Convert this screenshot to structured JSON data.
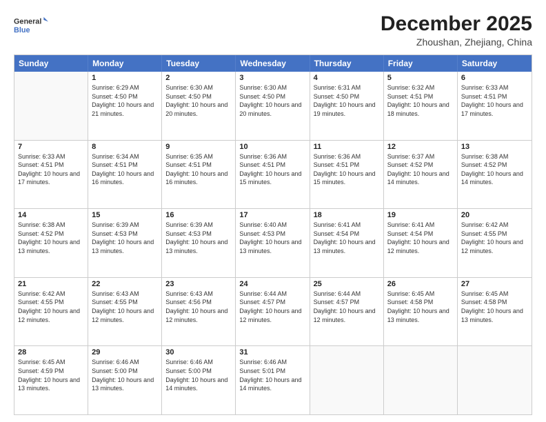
{
  "header": {
    "logo_general": "General",
    "logo_blue": "Blue",
    "month_title": "December 2025",
    "location": "Zhoushan, Zhejiang, China"
  },
  "calendar": {
    "days_of_week": [
      "Sunday",
      "Monday",
      "Tuesday",
      "Wednesday",
      "Thursday",
      "Friday",
      "Saturday"
    ],
    "rows": [
      [
        {
          "day": "",
          "sunrise": "",
          "sunset": "",
          "daylight": ""
        },
        {
          "day": "1",
          "sunrise": "6:29 AM",
          "sunset": "4:50 PM",
          "daylight": "10 hours and 21 minutes."
        },
        {
          "day": "2",
          "sunrise": "6:30 AM",
          "sunset": "4:50 PM",
          "daylight": "10 hours and 20 minutes."
        },
        {
          "day": "3",
          "sunrise": "6:30 AM",
          "sunset": "4:50 PM",
          "daylight": "10 hours and 20 minutes."
        },
        {
          "day": "4",
          "sunrise": "6:31 AM",
          "sunset": "4:50 PM",
          "daylight": "10 hours and 19 minutes."
        },
        {
          "day": "5",
          "sunrise": "6:32 AM",
          "sunset": "4:51 PM",
          "daylight": "10 hours and 18 minutes."
        },
        {
          "day": "6",
          "sunrise": "6:33 AM",
          "sunset": "4:51 PM",
          "daylight": "10 hours and 17 minutes."
        }
      ],
      [
        {
          "day": "7",
          "sunrise": "6:33 AM",
          "sunset": "4:51 PM",
          "daylight": "10 hours and 17 minutes."
        },
        {
          "day": "8",
          "sunrise": "6:34 AM",
          "sunset": "4:51 PM",
          "daylight": "10 hours and 16 minutes."
        },
        {
          "day": "9",
          "sunrise": "6:35 AM",
          "sunset": "4:51 PM",
          "daylight": "10 hours and 16 minutes."
        },
        {
          "day": "10",
          "sunrise": "6:36 AM",
          "sunset": "4:51 PM",
          "daylight": "10 hours and 15 minutes."
        },
        {
          "day": "11",
          "sunrise": "6:36 AM",
          "sunset": "4:51 PM",
          "daylight": "10 hours and 15 minutes."
        },
        {
          "day": "12",
          "sunrise": "6:37 AM",
          "sunset": "4:52 PM",
          "daylight": "10 hours and 14 minutes."
        },
        {
          "day": "13",
          "sunrise": "6:38 AM",
          "sunset": "4:52 PM",
          "daylight": "10 hours and 14 minutes."
        }
      ],
      [
        {
          "day": "14",
          "sunrise": "6:38 AM",
          "sunset": "4:52 PM",
          "daylight": "10 hours and 13 minutes."
        },
        {
          "day": "15",
          "sunrise": "6:39 AM",
          "sunset": "4:53 PM",
          "daylight": "10 hours and 13 minutes."
        },
        {
          "day": "16",
          "sunrise": "6:39 AM",
          "sunset": "4:53 PM",
          "daylight": "10 hours and 13 minutes."
        },
        {
          "day": "17",
          "sunrise": "6:40 AM",
          "sunset": "4:53 PM",
          "daylight": "10 hours and 13 minutes."
        },
        {
          "day": "18",
          "sunrise": "6:41 AM",
          "sunset": "4:54 PM",
          "daylight": "10 hours and 13 minutes."
        },
        {
          "day": "19",
          "sunrise": "6:41 AM",
          "sunset": "4:54 PM",
          "daylight": "10 hours and 12 minutes."
        },
        {
          "day": "20",
          "sunrise": "6:42 AM",
          "sunset": "4:55 PM",
          "daylight": "10 hours and 12 minutes."
        }
      ],
      [
        {
          "day": "21",
          "sunrise": "6:42 AM",
          "sunset": "4:55 PM",
          "daylight": "10 hours and 12 minutes."
        },
        {
          "day": "22",
          "sunrise": "6:43 AM",
          "sunset": "4:55 PM",
          "daylight": "10 hours and 12 minutes."
        },
        {
          "day": "23",
          "sunrise": "6:43 AM",
          "sunset": "4:56 PM",
          "daylight": "10 hours and 12 minutes."
        },
        {
          "day": "24",
          "sunrise": "6:44 AM",
          "sunset": "4:57 PM",
          "daylight": "10 hours and 12 minutes."
        },
        {
          "day": "25",
          "sunrise": "6:44 AM",
          "sunset": "4:57 PM",
          "daylight": "10 hours and 12 minutes."
        },
        {
          "day": "26",
          "sunrise": "6:45 AM",
          "sunset": "4:58 PM",
          "daylight": "10 hours and 13 minutes."
        },
        {
          "day": "27",
          "sunrise": "6:45 AM",
          "sunset": "4:58 PM",
          "daylight": "10 hours and 13 minutes."
        }
      ],
      [
        {
          "day": "28",
          "sunrise": "6:45 AM",
          "sunset": "4:59 PM",
          "daylight": "10 hours and 13 minutes."
        },
        {
          "day": "29",
          "sunrise": "6:46 AM",
          "sunset": "5:00 PM",
          "daylight": "10 hours and 13 minutes."
        },
        {
          "day": "30",
          "sunrise": "6:46 AM",
          "sunset": "5:00 PM",
          "daylight": "10 hours and 14 minutes."
        },
        {
          "day": "31",
          "sunrise": "6:46 AM",
          "sunset": "5:01 PM",
          "daylight": "10 hours and 14 minutes."
        },
        {
          "day": "",
          "sunrise": "",
          "sunset": "",
          "daylight": ""
        },
        {
          "day": "",
          "sunrise": "",
          "sunset": "",
          "daylight": ""
        },
        {
          "day": "",
          "sunrise": "",
          "sunset": "",
          "daylight": ""
        }
      ]
    ]
  }
}
